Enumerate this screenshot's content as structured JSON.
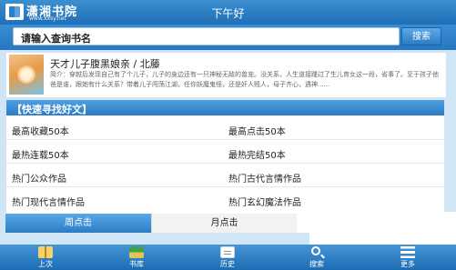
{
  "header": {
    "logo_title": "潇湘书院",
    "logo_url": "www.xxsy.net",
    "greeting": "下午好"
  },
  "search": {
    "placeholder": "请输入查询书名",
    "button_label": "搜索"
  },
  "featured_book": {
    "title": "天才儿子腹黑娘亲 / 北藤",
    "description": "简介：穿越后发现自己有了个儿子，儿子的身边还有一只神秘无敌的兽宠。没关系，人生道接踵过了生儿育女这一段，省事了。至于孩子他爸是谁，跟她有什么关系？带着儿子闯荡江湖，任你妖魔鬼怪，还是奸人贱人，母子齐心，遇神......"
  },
  "quick_find": {
    "title": "【快速寻找好文】",
    "rank_links": [
      {
        "label": "最高收藏50本"
      },
      {
        "label": "最高点击50本"
      },
      {
        "label": "最热连载50本"
      },
      {
        "label": "最热完结50本"
      },
      {
        "label": "热门公众作品"
      },
      {
        "label": "热门古代言情作品"
      },
      {
        "label": "热门现代言情作品"
      },
      {
        "label": "热门玄幻魔法作品"
      }
    ]
  },
  "tabs": [
    {
      "label": "周点击",
      "active": true
    },
    {
      "label": "月点击",
      "active": false
    }
  ],
  "footer_nav": [
    {
      "label": "上次",
      "icon": "book-icon"
    },
    {
      "label": "书库",
      "icon": "bookshelf-icon"
    },
    {
      "label": "历史",
      "icon": "history-icon"
    },
    {
      "label": "搜索",
      "icon": "search-icon"
    },
    {
      "label": "更多",
      "icon": "more-icon"
    }
  ],
  "colors": {
    "primary_blue": "#2b7cc5",
    "header_blue": "#1e6fb6",
    "background": "#cfe6f6"
  }
}
